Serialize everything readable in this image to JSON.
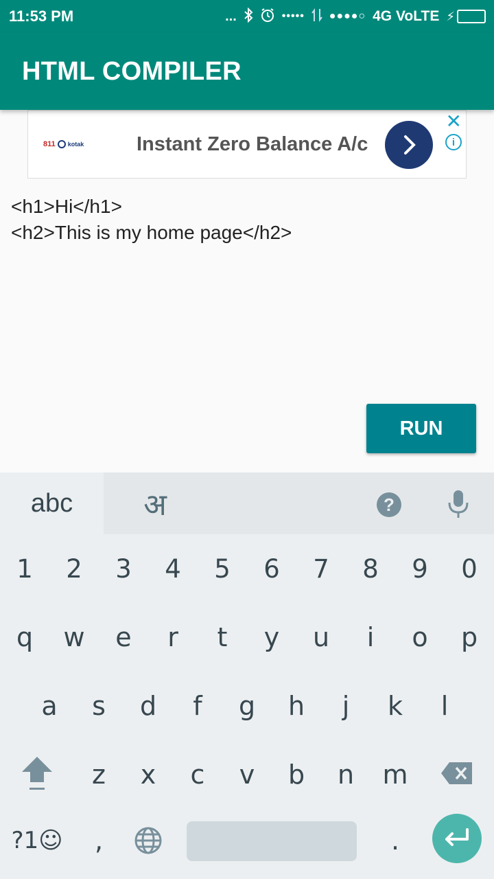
{
  "status_bar": {
    "time": "11:53 PM",
    "dots": "...",
    "signal_dots": "•••••",
    "sim_dots": "●●●●○",
    "network": "4G VoLTE"
  },
  "app_bar": {
    "title": "HTML COMPILER"
  },
  "ad": {
    "logo_text": "811",
    "logo_sub": "kotak",
    "headline": "Instant Zero Balance A/c",
    "close_glyph": "✕",
    "info_glyph": "i"
  },
  "editor": {
    "content": "<h1>Hi</h1>\n<h2>This is my home page</h2>"
  },
  "run_button": {
    "label": "RUN"
  },
  "keyboard": {
    "mode_abc": "abc",
    "mode_hindi": "अ",
    "help_glyph": "?",
    "numbers": [
      "1",
      "2",
      "3",
      "4",
      "5",
      "6",
      "7",
      "8",
      "9",
      "0"
    ],
    "row1": [
      "q",
      "w",
      "e",
      "r",
      "t",
      "y",
      "u",
      "i",
      "o",
      "p"
    ],
    "row2": [
      "a",
      "s",
      "d",
      "f",
      "g",
      "h",
      "j",
      "k",
      "l"
    ],
    "row3": [
      "z",
      "x",
      "c",
      "v",
      "b",
      "n",
      "m"
    ],
    "symbols_label": "?1☺",
    "comma": ",",
    "period": "."
  },
  "colors": {
    "primary": "#00897b",
    "run_button": "#00838f",
    "enter_key": "#4db6ac",
    "ad_button": "#1f3a73"
  }
}
